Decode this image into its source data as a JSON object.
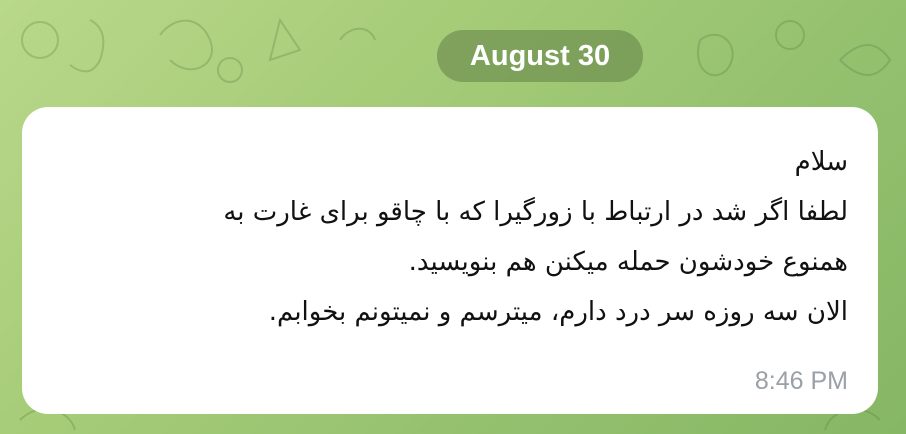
{
  "chat": {
    "date_separator": "August 30",
    "message": {
      "lines": [
        "سلام",
        "لطفا اگر شد در ارتباط با زورگیرا که با چاقو برای غارت به",
        "همنوع خودشون حمله میکنن هم بنویسید.",
        "الان سه روزه سر درد دارم، میترسم و نمیتونم بخوابم."
      ],
      "time": "8:46 PM"
    }
  },
  "colors": {
    "wallpaper": "#a6cc78",
    "bubble": "#ffffff",
    "date_pill": "#60804699",
    "time_text": "#9aa0a6"
  }
}
